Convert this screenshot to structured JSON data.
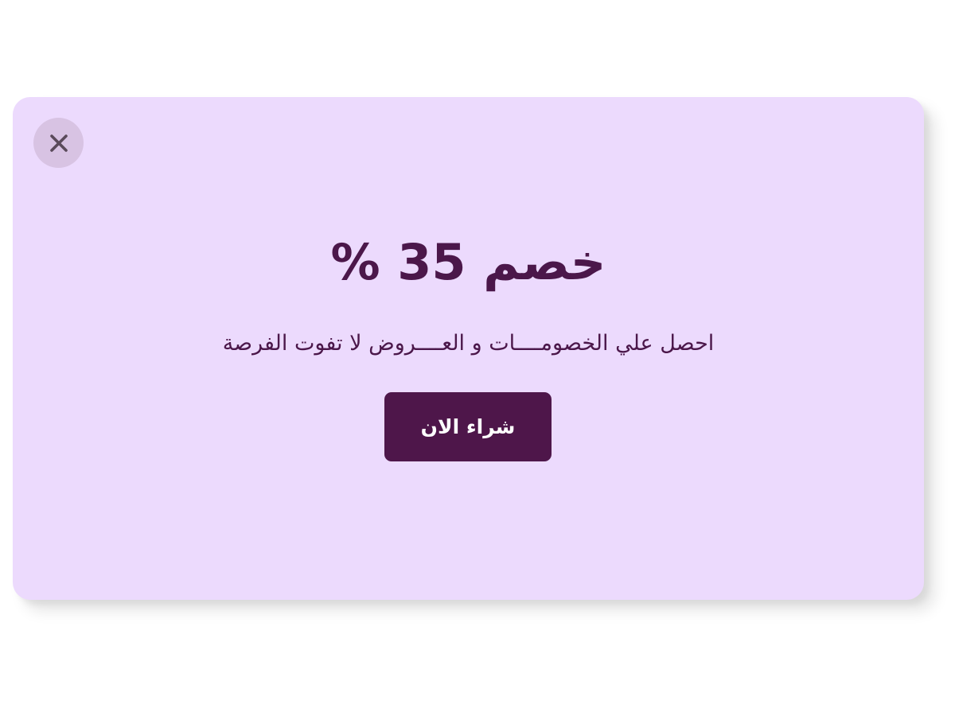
{
  "popup": {
    "headline": "خصم 35 %",
    "subtitle": "احصل علي الخصومــــات و العــــروض لا تفوت الفرصة",
    "buy_button_label": "شراء الان",
    "close_icon": "close-icon"
  },
  "colors": {
    "page_background": "#ffffff",
    "popup_background": "#ecdafd",
    "close_button_background": "#d8c3e3",
    "close_icon": "#5a4a5a",
    "headline_text": "#4b174a",
    "button_background": "#4e164a",
    "button_text": "#ffffff"
  }
}
